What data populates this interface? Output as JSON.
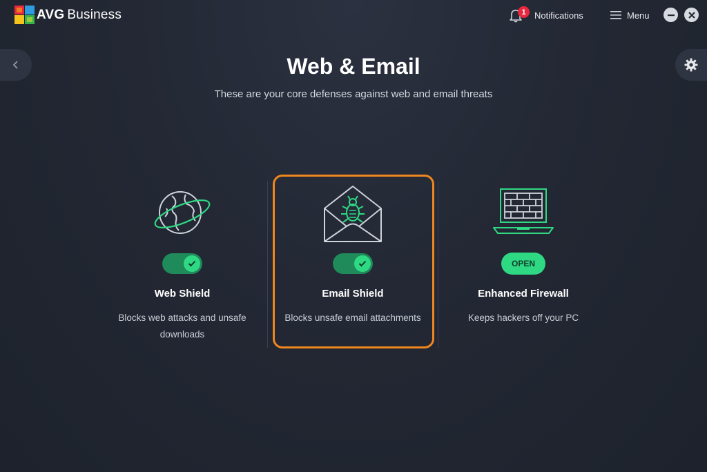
{
  "app": {
    "brand_main": "AVG",
    "brand_sub": "Business"
  },
  "header": {
    "notifications_label": "Notifications",
    "notifications_count": "1",
    "menu_label": "Menu"
  },
  "page": {
    "title": "Web & Email",
    "subtitle": "These are your core defenses against web and email threats"
  },
  "cards": [
    {
      "title": "Web Shield",
      "desc_line1": "Blocks web attacks and unsafe",
      "desc_line2": "downloads",
      "state": "on",
      "icon": "globe-icon"
    },
    {
      "title": "Email Shield",
      "desc_line1": "Blocks unsafe email attachments",
      "state": "on",
      "icon": "envelope-bug-icon"
    },
    {
      "title": "Enhanced Firewall",
      "desc_line1": "Keeps hackers off your PC",
      "state": "open",
      "button_label": "OPEN",
      "icon": "laptop-firewall-icon"
    }
  ],
  "colors": {
    "accent_green": "#2fd983",
    "highlight_orange": "#f0871f",
    "badge_red": "#e8283e"
  }
}
